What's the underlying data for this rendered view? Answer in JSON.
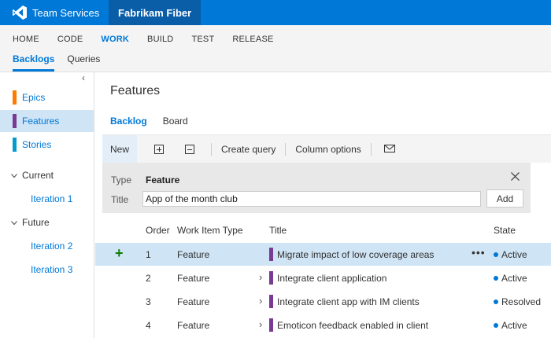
{
  "header": {
    "brand": "Team Services",
    "separator": "/",
    "project": "Fabrikam Fiber"
  },
  "hubs": [
    "HOME",
    "CODE",
    "WORK",
    "BUILD",
    "TEST",
    "RELEASE"
  ],
  "active_hub": "WORK",
  "pivots": [
    "Backlogs",
    "Queries"
  ],
  "sidebar": {
    "collapse_glyph": "‹",
    "backlogs": [
      {
        "label": "Epics",
        "color": "#ff7b00"
      },
      {
        "label": "Features",
        "color": "#773b93"
      },
      {
        "label": "Stories",
        "color": "#009ccc"
      }
    ],
    "groups": [
      {
        "label": "Current",
        "items": [
          "Iteration 1"
        ]
      },
      {
        "label": "Future",
        "items": [
          "Iteration 2",
          "Iteration 3"
        ]
      }
    ]
  },
  "main": {
    "title": "Features",
    "tabs": [
      "Backlog",
      "Board"
    ],
    "toolbar": {
      "new": "New",
      "create_query": "Create query",
      "column_options": "Column options"
    },
    "add_panel": {
      "type_label": "Type",
      "type_value": "Feature",
      "title_label": "Title",
      "title_value": "App of the month club",
      "add_button": "Add"
    },
    "columns": [
      "Order",
      "Work Item Type",
      "Title",
      "State"
    ],
    "rows": [
      {
        "order": "1",
        "type": "Feature",
        "title": "Migrate impact of low coverage areas",
        "state": "Active"
      },
      {
        "order": "2",
        "type": "Feature",
        "title": "Integrate client application",
        "state": "Active"
      },
      {
        "order": "3",
        "type": "Feature",
        "title": "Integrate client app with IM clients",
        "state": "Resolved"
      },
      {
        "order": "4",
        "type": "Feature",
        "title": "Emoticon feedback enabled in client",
        "state": "Active"
      }
    ]
  },
  "colors": {
    "accent": "#0078d7",
    "feature": "#773b93",
    "active_state": "#0078d7",
    "add_green": "#107c10"
  },
  "icons": {
    "expand": "plus-square-icon",
    "collapse": "minus-square-icon",
    "email": "mail-icon",
    "close": "close-icon",
    "add_row": "plus-icon",
    "more": "more-icon"
  }
}
